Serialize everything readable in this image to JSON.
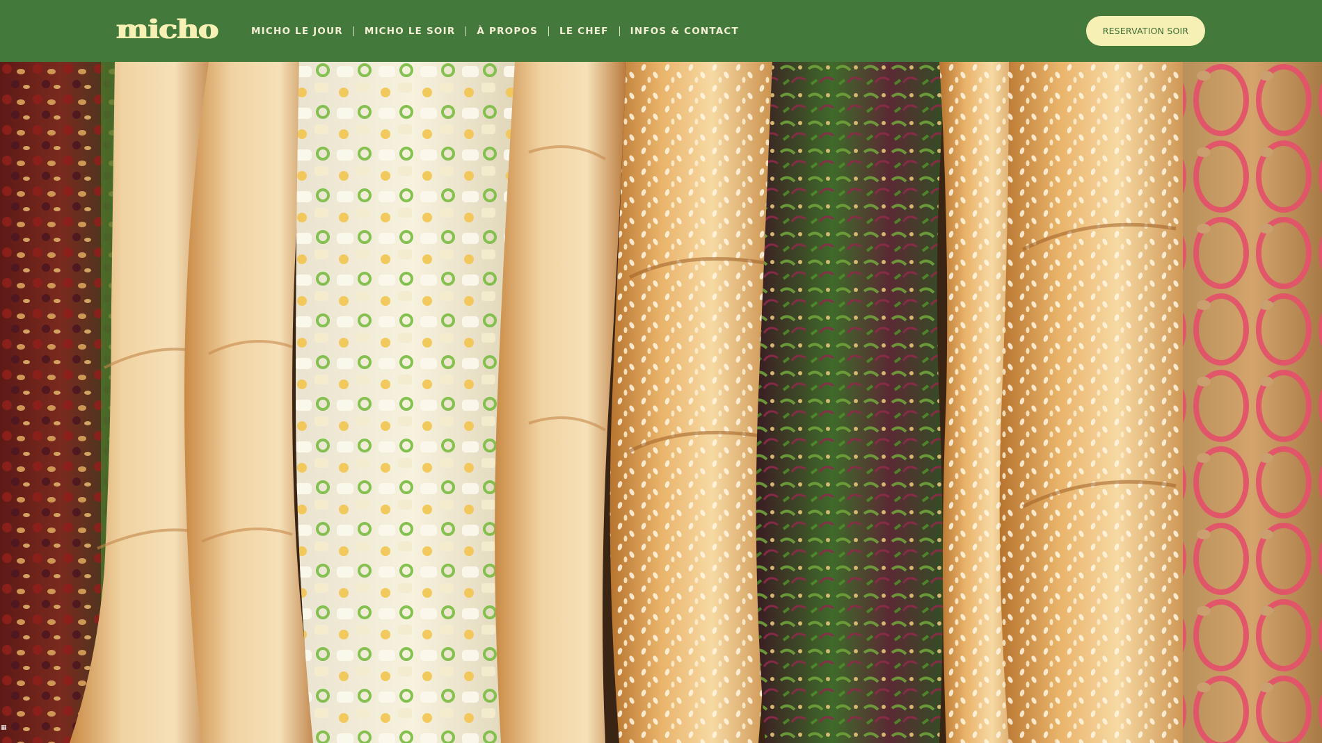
{
  "brand": {
    "logo_text": "micho",
    "colors": {
      "header_bg": "#44793c",
      "logo": "#f7f0b4",
      "nav_text": "#f4efd6",
      "button_bg": "#f7f0b4",
      "button_text": "#3d6b35"
    }
  },
  "nav": {
    "items": [
      {
        "label": "MICHO LE JOUR"
      },
      {
        "label": "MICHO LE SOIR"
      },
      {
        "label": "À PROPOS"
      },
      {
        "label": "LE CHEF"
      },
      {
        "label": "INFOS & CONTACT"
      }
    ]
  },
  "header": {
    "reserve_label": "RESERVATION SOIR"
  },
  "hero": {
    "image_icon": "hero-photo-sandwiches-icon",
    "sandwich_count": 4
  }
}
